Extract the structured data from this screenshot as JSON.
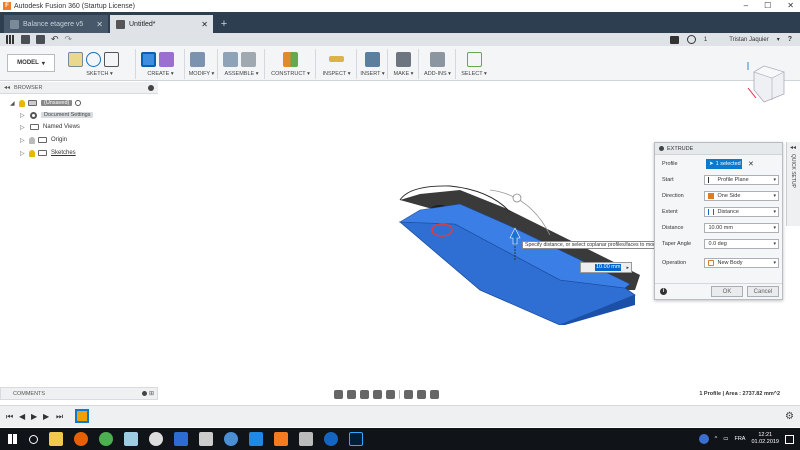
{
  "window": {
    "title": "Autodesk Fusion 360 (Startup License)",
    "controls": [
      "–",
      "☐",
      "✕"
    ]
  },
  "tabs": [
    {
      "label": "Balance etagere v5",
      "active": false
    },
    {
      "label": "Untitled*",
      "active": true
    }
  ],
  "header": {
    "job_status_count": "1",
    "user": "Tristan Jaquier",
    "help": "?"
  },
  "toolbar": {
    "workspace": "MODEL",
    "groups": [
      "SKETCH",
      "CREATE",
      "MODIFY",
      "ASSEMBLE",
      "CONSTRUCT",
      "INSPECT",
      "INSERT",
      "MAKE",
      "ADD-INS",
      "SELECT"
    ]
  },
  "browser": {
    "title": "BROWSER",
    "root": "(Unsaved)",
    "items": [
      "Document Settings",
      "Named Views",
      "Origin",
      "Sketches"
    ]
  },
  "canvas": {
    "tooltip": "Specify distance, or select coplanar profiles/faces to modify the selection",
    "distance_value": "10.00 mm"
  },
  "extrude": {
    "title": "EXTRUDE",
    "rows": [
      {
        "label": "Profile",
        "value": "1 selected"
      },
      {
        "label": "Start",
        "value": "Profile Plane"
      },
      {
        "label": "Direction",
        "value": "One Side"
      },
      {
        "label": "Extent",
        "value": "Distance"
      },
      {
        "label": "Distance",
        "value": "10.00 mm"
      },
      {
        "label": "Taper Angle",
        "value": "0.0 deg"
      },
      {
        "label": "Operation",
        "value": "New Body"
      }
    ],
    "ok": "OK",
    "cancel": "Cancel",
    "side_tab": "QUICK SETUP"
  },
  "bottom": {
    "comments": "COMMENTS",
    "status": "1 Profile | Area : 2737.82 mm^2"
  },
  "taskbar": {
    "lang": "FRA",
    "time": "12:21",
    "date": "01.02.2019"
  },
  "colors": {
    "accent": "#0a7ad0",
    "tab_bar": "#2c3e50",
    "extrude_face": "#2f6fd4"
  }
}
